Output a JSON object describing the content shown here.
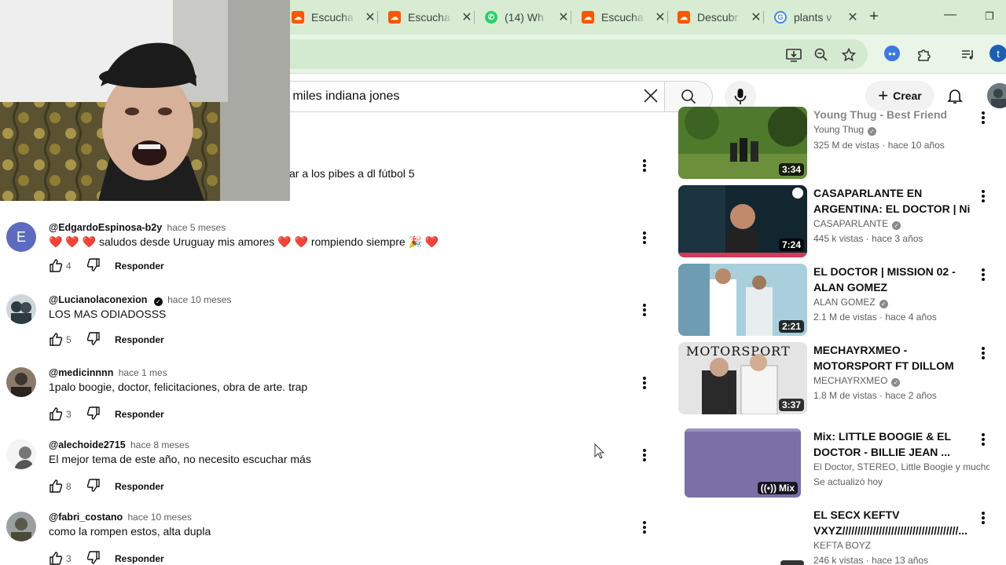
{
  "browser": {
    "tabs": [
      {
        "label": "Escucha",
        "favicon": "soundcloud-icon"
      },
      {
        "label": "Escucha",
        "favicon": "soundcloud-icon"
      },
      {
        "label": "(14) Wh",
        "favicon": "whatsapp-icon"
      },
      {
        "label": "Escucha",
        "favicon": "soundcloud-icon"
      },
      {
        "label": "Descubr",
        "favicon": "soundcloud-icon"
      },
      {
        "label": "plants v",
        "favicon": "google-icon"
      }
    ],
    "profile_initial": "t",
    "accent_color": "#d7ecd2"
  },
  "youtube": {
    "search_query": "o miles indiana jones",
    "create_label": "Crear"
  },
  "partial_comment": {
    "text": "ar a los pibes a dl fútbol 5"
  },
  "comments": [
    {
      "avatar_letter": "E",
      "avatar_color": "#5c6bc0",
      "handle": "@EdgardoEspinosa-b2y",
      "age": "hace 5 meses",
      "text": "❤️ ❤️ ❤️  saludos desde Uruguay mis amores ❤️ ❤️  rompiendo siempre 🎉 ❤️",
      "likes": "4",
      "reply": "Responder"
    },
    {
      "avatar_letter": "",
      "avatar_color": "#2c3a44",
      "handle": "@Lucianolaconexion",
      "verified": "✓",
      "age": "hace 10 meses",
      "text": "LOS MAS ODIADOSSS",
      "likes": "5",
      "reply": "Responder"
    },
    {
      "avatar_letter": "",
      "avatar_color": "#3d3530",
      "handle": "@medicinnnn",
      "age": "hace 1 mes",
      "text": "1palo boogie, doctor, felicitaciones, obra de arte. trap",
      "likes": "3",
      "reply": "Responder"
    },
    {
      "avatar_letter": "",
      "avatar_color": "#dddddd",
      "handle": "@alechoide2715",
      "age": "hace 8 meses",
      "text": "El mejor tema de este año, no necesito escuchar más",
      "likes": "8",
      "reply": "Responder"
    },
    {
      "avatar_letter": "",
      "avatar_color": "#6a6a5a",
      "handle": "@fabri_costano",
      "age": "hace 10 meses",
      "text": "como la rompen estos, alta dupla",
      "likes": "3",
      "reply": "Responder"
    }
  ],
  "sidebar": [
    {
      "title": "Young Thug - Best Friend",
      "channel": "Young Thug",
      "verified": true,
      "views": "325 M de vistas · hace 10 años",
      "duration": "3:34",
      "thumb_colors": [
        "#4f7a2c",
        "#2f4a1a"
      ]
    },
    {
      "title": "CASAPARLANTE EN ARGENTINA: EL DOCTOR | Ni ...",
      "channel": "CASAPARLANTE",
      "verified": true,
      "views": "445 k vistas · hace 3 años",
      "duration": "7:24",
      "thumb_colors": [
        "#1c3340",
        "#0b1a24"
      ]
    },
    {
      "title": "EL DOCTOR | MISSION 02 - ALAN GOMEZ",
      "channel": "ALAN GOMEZ",
      "verified": true,
      "views": "2.1 M de vistas · hace 4 años",
      "duration": "2:21",
      "thumb_colors": [
        "#b7d7e2",
        "#5e8fa8"
      ]
    },
    {
      "title": "MECHAYRXMEO - MOTORSPORT FT DILLOM",
      "channel": "MECHAYRXMEO",
      "verified": true,
      "views": "1.8 M de vistas · hace 2 años",
      "duration": "3:37",
      "thumb_colors": [
        "#cfcfcf",
        "#2a2a2a"
      ],
      "thumb_text": "MOTORSPORT"
    },
    {
      "title": "Mix: LITTLE BOOGIE & EL DOCTOR - BILLIE JEAN ...",
      "channel": "El Doctor, STEREO, Little Boogie y mucho...",
      "verified": false,
      "views": "Se actualizó hoy",
      "duration": "Mix",
      "thumb_colors": [
        "#7a6fa6",
        "#6a5f96"
      ]
    },
    {
      "title": "EL SECX KEFTV VXYZ//////////////////////////////////////...",
      "channel": "KEFTA BOYZ",
      "verified": false,
      "views": "246 k vistas · hace 13 años",
      "duration": "",
      "thumb_colors": [
        "#ffffff",
        "#ffffff"
      ]
    }
  ]
}
